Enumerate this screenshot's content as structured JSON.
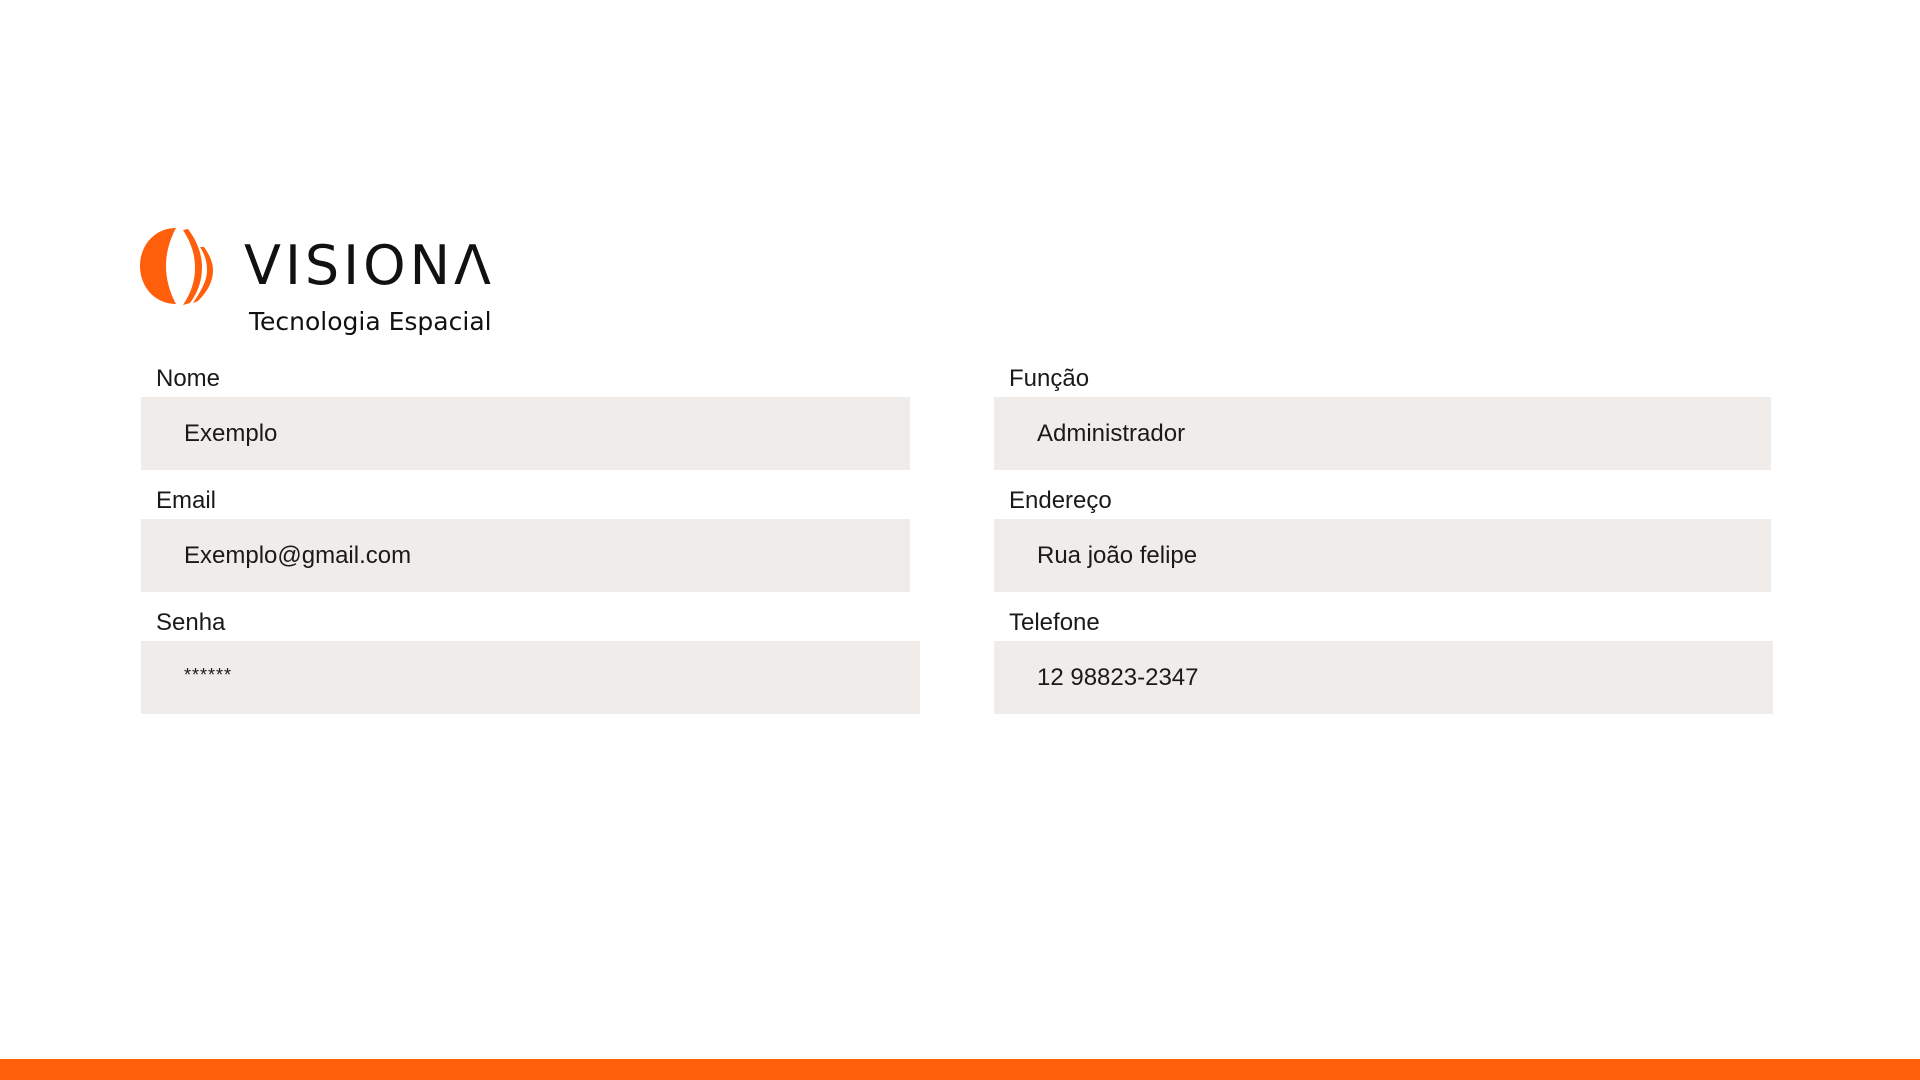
{
  "brand": {
    "name": "VISIONΛ",
    "tagline": "Tecnologia Espacial",
    "logo_icon": "visiona-logo-icon",
    "accent_color": "#ff5f0a"
  },
  "form": {
    "left": [
      {
        "label": "Nome",
        "value": "Exemplo"
      },
      {
        "label": "Email",
        "value": "Exemplo@gmail.com"
      },
      {
        "label": "Senha",
        "value": "******"
      }
    ],
    "right": [
      {
        "label": "Função",
        "value": "Administrador"
      },
      {
        "label": "Endereço",
        "value": "Rua joão felipe"
      },
      {
        "label": "Telefone",
        "value": "12 98823-2347"
      }
    ],
    "field_background": "#f0ece9"
  }
}
